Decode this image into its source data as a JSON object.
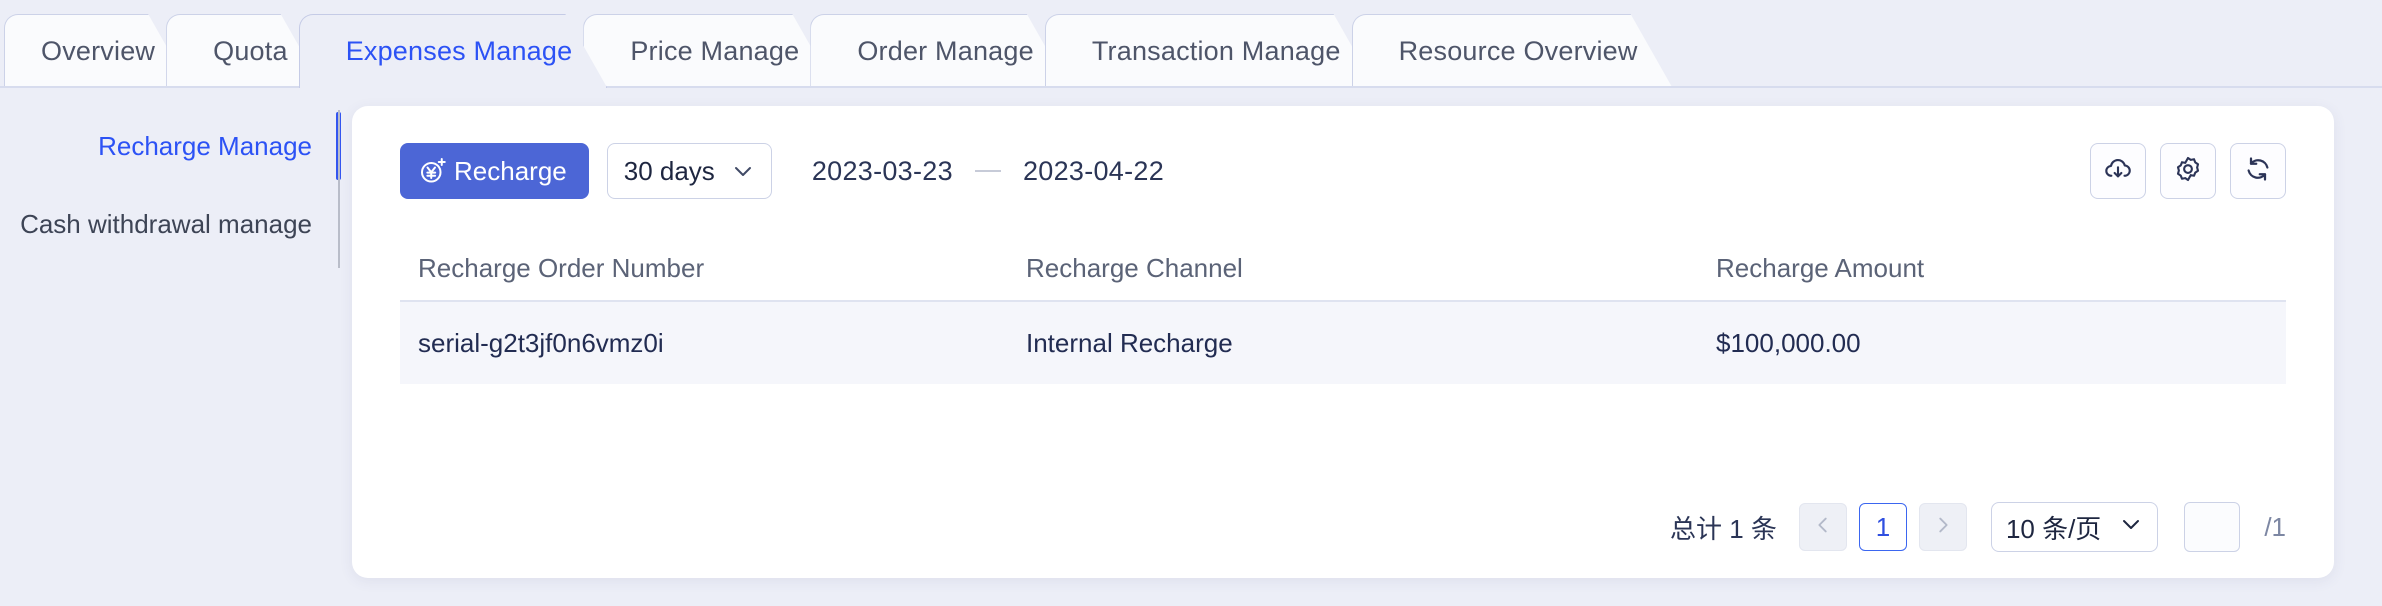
{
  "tabs": [
    {
      "label": "Overview",
      "active": false
    },
    {
      "label": "Quota",
      "active": false
    },
    {
      "label": "Expenses Manage",
      "active": true
    },
    {
      "label": "Price Manage",
      "active": false
    },
    {
      "label": "Order Manage",
      "active": false
    },
    {
      "label": "Transaction Manage",
      "active": false
    },
    {
      "label": "Resource Overview",
      "active": false
    }
  ],
  "sidebar": {
    "items": [
      {
        "label": "Recharge Manage",
        "active": true
      },
      {
        "label": "Cash withdrawal manage",
        "active": false
      }
    ]
  },
  "toolbar": {
    "recharge_label": "Recharge",
    "recharge_icon": "yuan-plus-circle-icon",
    "range_select_value": "30 days",
    "date_start": "2023-03-23",
    "date_separator": "—",
    "date_end": "2023-04-22",
    "actions": [
      {
        "name": "download-icon",
        "title": "download"
      },
      {
        "name": "gear-icon",
        "title": "settings"
      },
      {
        "name": "refresh-icon",
        "title": "refresh"
      }
    ]
  },
  "table": {
    "columns": [
      "Recharge Order Number",
      "Recharge Channel",
      "Recharge Amount"
    ],
    "rows": [
      {
        "order_number": "serial-g2t3jf0n6vmz0i",
        "channel": "Internal Recharge",
        "amount": "$100,000.00"
      }
    ]
  },
  "pagination": {
    "total_text": "总计 1 条",
    "prev_icon": "chevron-left-icon",
    "next_icon": "chevron-right-icon",
    "current_page": "1",
    "page_size_label": "10 条/页",
    "jump_value": "",
    "total_pages_label": "/1"
  },
  "colors": {
    "page_bg": "#eceef7",
    "accent_blue": "#2c52f5",
    "button_blue": "#4c66d6",
    "card_bg": "#ffffff",
    "row_bg": "#f5f6fb",
    "text_dark": "#222c52",
    "text_muted": "#5b6377"
  }
}
